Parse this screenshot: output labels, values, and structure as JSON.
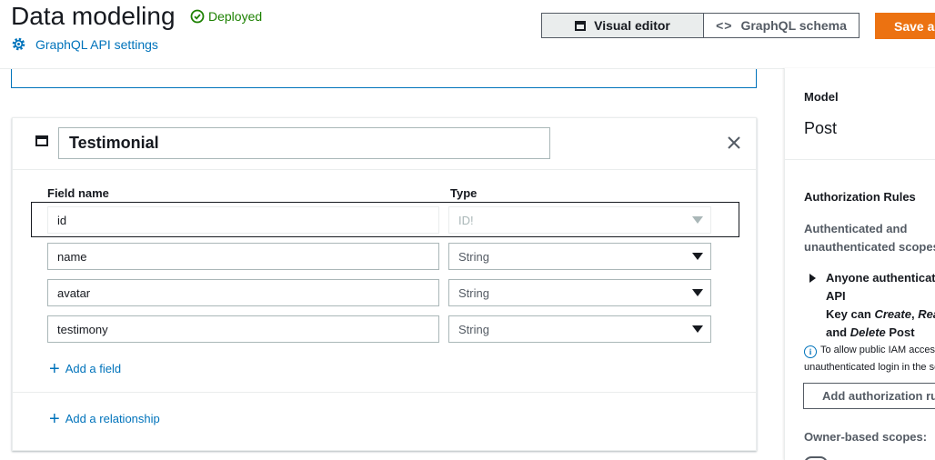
{
  "header": {
    "title": "Data modeling",
    "status": "Deployed",
    "api_settings": "GraphQL API settings",
    "visual_editor": "Visual editor",
    "graphql_schema": "GraphQL schema",
    "save_button": "Save and Deploy",
    "colors": {
      "deployed": "#1d8102",
      "link": "#0073bb",
      "primary": "#ec7211"
    }
  },
  "model_card": {
    "name": "Testimonial",
    "col_field": "Field name",
    "col_type": "Type",
    "fields": [
      {
        "name": "id",
        "type": "ID!"
      },
      {
        "name": "name",
        "type": "String"
      },
      {
        "name": "avatar",
        "type": "String"
      },
      {
        "name": "testimony",
        "type": "String"
      }
    ],
    "add_field": "Add a field",
    "add_relationship": "Add a relationship"
  },
  "panel": {
    "model_label": "Model",
    "model_value": "Post",
    "auth_heading": "Authorization Rules",
    "auth_subheading": "Authenticated and unauthenticated scopes:",
    "rule": {
      "line1": "Anyone authenticated with API",
      "line2_pre": "Key can ",
      "line2_create": "Create",
      "line2_sep": ", ",
      "line2_read": "Read",
      "line3_pre": "and ",
      "line3_delete": "Delete",
      "line3_post": " Post"
    },
    "info_line1": "To allow public IAM access, enable",
    "info_line2": "unauthenticated login in the settings",
    "add_auth_button": "Add authorization rule",
    "owner_scopes": "Owner-based scopes:"
  }
}
